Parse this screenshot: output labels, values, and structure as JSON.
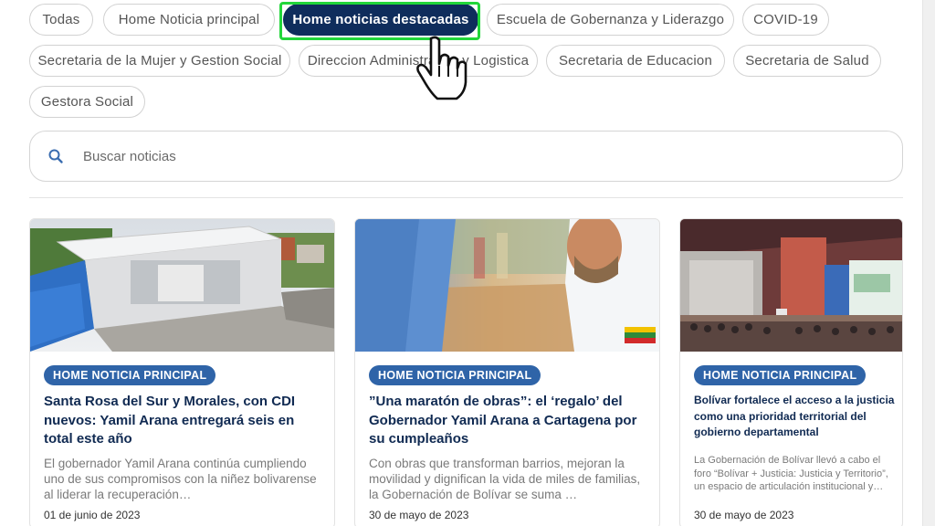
{
  "filters": {
    "chips": [
      "Todas",
      "Home Noticia principal",
      "Home noticias destacadas",
      "Escuela de Gobernanza y Liderazgo",
      "COVID-19",
      "Secretaria de la Mujer y Gestion Social",
      "Direccion Administrativa y Logistica",
      "Secretaria de Educacion",
      "Secretaria de Salud",
      "Gestora Social"
    ],
    "active_index": 2
  },
  "search": {
    "placeholder": "Buscar noticias",
    "value": ""
  },
  "cards": [
    {
      "tag": "HOME NOTICIA PRINCIPAL",
      "title": "Santa Rosa del Sur y Morales, con CDI nuevos: Yamil Arana entregará seis en total este año",
      "excerpt": "El gobernador Yamil Arana continúa cumpliendo uno de sus compromisos con la niñez bolivarense al liderar la recuperación…",
      "date": "01 de junio de 2023"
    },
    {
      "tag": "HOME NOTICIA PRINCIPAL",
      "title": "”Una maratón de obras”: el ‘regalo’ del Gobernador Yamil Arana a Cartagena por su cumpleaños",
      "excerpt": "Con obras que transforman barrios, mejoran la movilidad y dignifican la vida de miles de familias, la Gobernación de Bolívar se suma …",
      "date": "30 de mayo de 2023"
    },
    {
      "tag": "HOME NOTICIA PRINCIPAL",
      "title": "Bolívar fortalece el acceso a la justicia como una prioridad territorial del gobierno departamental",
      "excerpt": "La Gobernación de Bolívar llevó a cabo el foro “Bolívar + Justicia: Justicia y Territorio”, un espacio de articulación institucional y…",
      "date": "30 de mayo de 2023"
    }
  ],
  "colors": {
    "active_chip": "#0f2d5c",
    "tag": "#2f64a8",
    "title": "#102a52",
    "highlight": "#22d63a"
  },
  "icons": {
    "search": "search-icon",
    "cursor": "hand-pointer-icon"
  }
}
